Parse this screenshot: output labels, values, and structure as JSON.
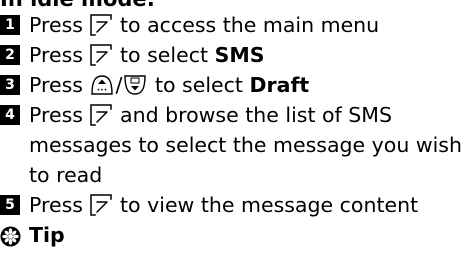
{
  "heading": "In idle mode:",
  "steps": [
    {
      "number": "1",
      "before": "Press",
      "key_icon": "menu-softkey-icon",
      "after": "to access the main menu"
    },
    {
      "number": "2",
      "before": "Press",
      "key_icon": "menu-softkey-icon",
      "after": "to select",
      "bold": "SMS"
    },
    {
      "number": "3",
      "before": "Press",
      "key_icon_up": "up-arrow-key-icon",
      "separator": "/",
      "key_icon_down": "down-arrow-key-icon",
      "after": "to select",
      "bold": "Draft"
    },
    {
      "number": "4",
      "before": "Press",
      "key_icon": "menu-softkey-icon",
      "after": "and browse the list of SMS messages to select the message you wish to read"
    },
    {
      "number": "5",
      "before": "Press",
      "key_icon": "menu-softkey-icon",
      "after": "to view the message content"
    }
  ],
  "tip": {
    "icon": "tip-gear-icon",
    "label": "Tip"
  }
}
